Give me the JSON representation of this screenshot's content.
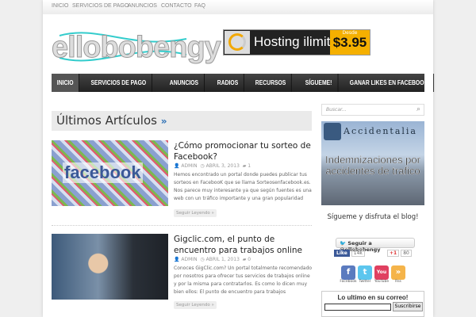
{
  "topnav": [
    "INICIO",
    "SERVICIOS DE PAGO",
    "ANUNCIOS",
    "CONTACTO",
    "FAQ"
  ],
  "logo": "ellobobengy",
  "banner": {
    "text": "Hosting ilimitado",
    "from": "Desde",
    "price": "$3.95"
  },
  "mainnav": [
    "INICIO",
    "SERVICIOS DE PAGO",
    "ANUNCIOS",
    "RADIOS",
    "RECURSOS",
    "SÍGUEME!",
    "GANAR LIKES EN FACEBOOK"
  ],
  "section_title": "Últimos Artículos",
  "section_arrow": "»",
  "articles": [
    {
      "title": "¿Cómo promocionar tu sorteo de Facebook?",
      "author": "ADMIN",
      "date": "ABRIL 3, 2013",
      "comments": "1",
      "excerpt": "Hemos encontrado un portal donde puedes publicar tus sorteos en FacebooK que se llama Sorteosenfacebook.es. Nos parece muy interesante ya que según fuentes es una web con un tráfico importante y una gran popularidad",
      "more": "Seguir Leyendo »",
      "image_text": "facebook"
    },
    {
      "title": "Gigclic.com, el punto de encuentro para trabajos online",
      "author": "ADMIN",
      "date": "ABRIL 1, 2013",
      "comments": "0",
      "excerpt": "Conoces GigClic.com? Un portal totalmente recomendado por nosotros para ofrecer tus servicios de trabajos online y por la misma para contratarlos. Es como lo dicen muy bien ellos: El punto de encuentro para trabajos",
      "more": "Seguir Leyendo »"
    }
  ],
  "sidebar": {
    "search_placeholder": "Buscar...",
    "ad": {
      "brand": "Accidentalia",
      "message": "Indemnizaciones por accidentes de trafico"
    },
    "follow_text": "Sígueme  y disfruta el blog!",
    "twitter_button": "Seguir a @ellobobengy",
    "fb_like": "Like",
    "fb_count": "14k",
    "gplus": "+1",
    "gplus_count": "80",
    "social": [
      {
        "label": "Facebook",
        "glyph": "f",
        "color": "#5b7bbf"
      },
      {
        "label": "Twitter",
        "glyph": "t",
        "color": "#5cc6ee"
      },
      {
        "label": "YouTube",
        "glyph": "You",
        "color": "#e04060"
      },
      {
        "label": "Rss",
        "glyph": "»",
        "color": "#f5b44a"
      }
    ],
    "newsletter_title": "Lo ultimo en su correo!",
    "subscribe": "Suscribirse"
  }
}
